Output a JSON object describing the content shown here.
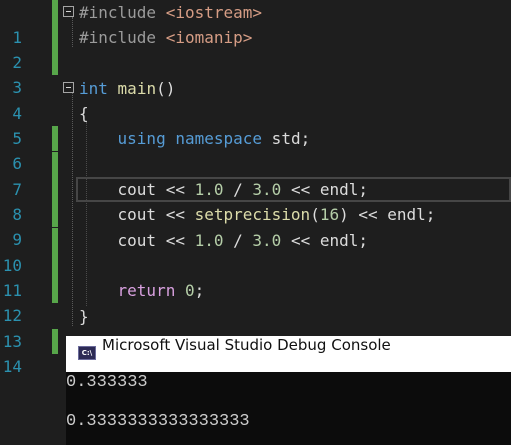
{
  "editor": {
    "lines": [
      {
        "n": "1",
        "parts": [
          {
            "t": "#include ",
            "c": "pp"
          },
          {
            "t": "<iostream>",
            "c": "inc"
          }
        ]
      },
      {
        "n": "2",
        "parts": [
          {
            "t": "#include ",
            "c": "pp"
          },
          {
            "t": "<iomanip>",
            "c": "inc"
          }
        ]
      },
      {
        "n": "3",
        "parts": []
      },
      {
        "n": "4",
        "parts": [
          {
            "t": "int",
            "c": "kw"
          },
          {
            "t": " "
          },
          {
            "t": "main",
            "c": "fn"
          },
          {
            "t": "()"
          }
        ]
      },
      {
        "n": "5",
        "parts": [
          {
            "t": "{"
          }
        ]
      },
      {
        "n": "6",
        "parts": [
          {
            "t": "    "
          },
          {
            "t": "using",
            "c": "kw"
          },
          {
            "t": " "
          },
          {
            "t": "namespace",
            "c": "kw"
          },
          {
            "t": " std;"
          }
        ]
      },
      {
        "n": "7",
        "parts": []
      },
      {
        "n": "8",
        "parts": [
          {
            "t": "    cout << "
          },
          {
            "t": "1.0",
            "c": "num"
          },
          {
            "t": " / "
          },
          {
            "t": "3.0",
            "c": "num"
          },
          {
            "t": " << endl;"
          }
        ]
      },
      {
        "n": "9",
        "parts": [
          {
            "t": "    cout << "
          },
          {
            "t": "setprecision",
            "c": "fn"
          },
          {
            "t": "("
          },
          {
            "t": "16",
            "c": "num"
          },
          {
            "t": ") << endl;"
          }
        ]
      },
      {
        "n": "10",
        "parts": [
          {
            "t": "    cout << "
          },
          {
            "t": "1.0",
            "c": "num"
          },
          {
            "t": " / "
          },
          {
            "t": "3.0",
            "c": "num"
          },
          {
            "t": " << endl;"
          }
        ]
      },
      {
        "n": "11",
        "parts": []
      },
      {
        "n": "12",
        "parts": [
          {
            "t": "    "
          },
          {
            "t": "return",
            "c": "kw2"
          },
          {
            "t": " "
          },
          {
            "t": "0",
            "c": "num"
          },
          {
            "t": ";"
          }
        ]
      },
      {
        "n": "13",
        "parts": [
          {
            "t": "}"
          }
        ]
      },
      {
        "n": "14",
        "parts": []
      }
    ]
  },
  "console": {
    "title": "Microsoft Visual Studio Debug Console",
    "icon_label": "C:\\",
    "output": [
      "0.333333",
      "0.3333333333333333"
    ]
  },
  "colors": {
    "background": "#1e1e1e",
    "line_number": "#2b91af",
    "keyword": "#569cd6",
    "include_path": "#d69d85",
    "change_margin": "#57a64a"
  }
}
